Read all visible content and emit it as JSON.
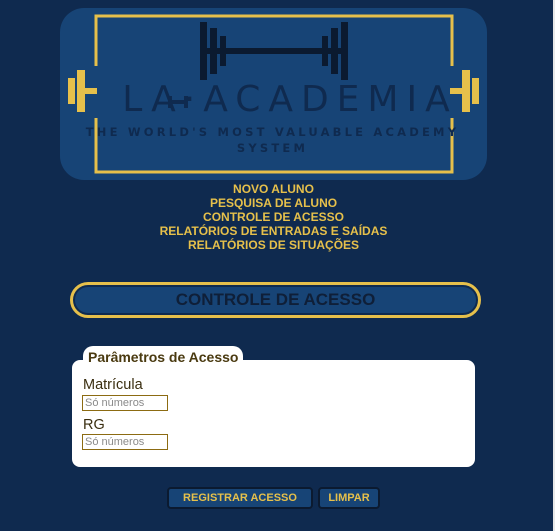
{
  "logo": {
    "title": "LA·ACADEMIA",
    "subtitle": "THE WORLD'S MOST VALUABLE ACADEMY SYSTEM",
    "colors": {
      "gold": "#e6c04b",
      "panel": "#174476",
      "dark": "#0f2a4f"
    }
  },
  "nav": {
    "items": [
      {
        "label": "NOVO ALUNO"
      },
      {
        "label": "PESQUISA DE ALUNO"
      },
      {
        "label": "CONTROLE DE ACESSO"
      },
      {
        "label": "RELATÓRIOS DE ENTRADAS E SAÍDAS"
      },
      {
        "label": "RELATÓRIOS DE SITUAÇÕES"
      }
    ]
  },
  "section": {
    "title": "CONTROLE DE ACESSO"
  },
  "params": {
    "legend": "Parâmetros de Acesso",
    "matricula": {
      "label": "Matrícula",
      "placeholder": "Só números",
      "value": ""
    },
    "rg": {
      "label": "RG",
      "placeholder": "Só números",
      "value": ""
    }
  },
  "actions": {
    "register_label": "REGISTRAR ACESSO",
    "clear_label": "LIMPAR"
  }
}
